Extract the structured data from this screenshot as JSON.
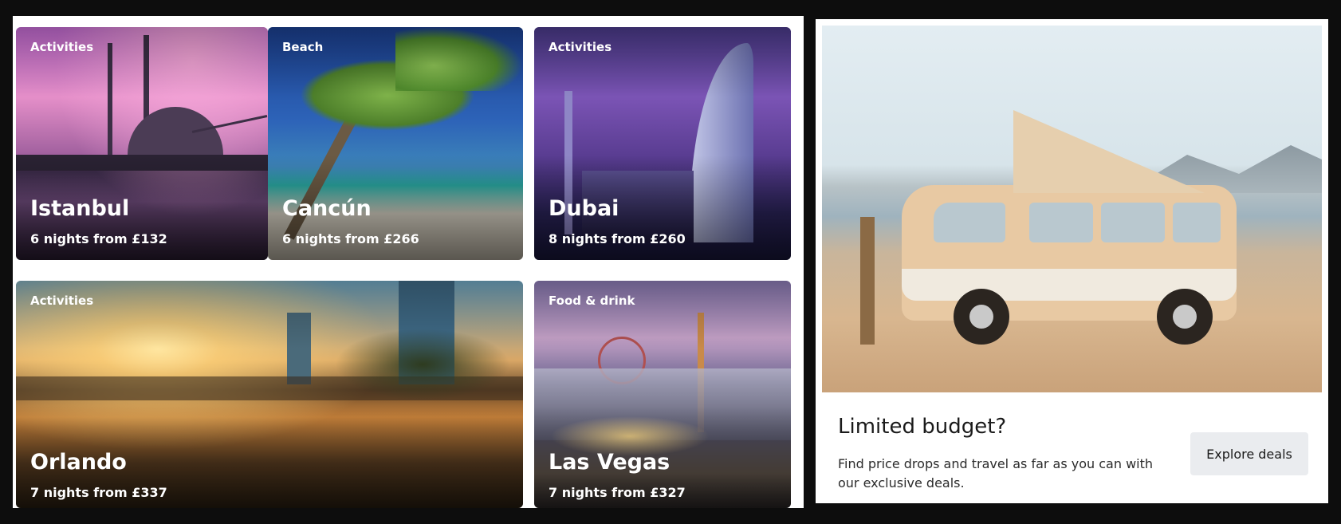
{
  "cards": [
    {
      "tag": "Activities",
      "city": "Istanbul",
      "price": "6 nights from £132"
    },
    {
      "tag": "Beach",
      "city": "Cancún",
      "price": "6 nights from £266"
    },
    {
      "tag": "Activities",
      "city": "Dubai",
      "price": "8 nights from £260"
    },
    {
      "tag": "Activities",
      "city": "Orlando",
      "price": "7 nights from £337"
    },
    {
      "tag": "Food & drink",
      "city": "Las Vegas",
      "price": "7 nights from £327"
    }
  ],
  "promo": {
    "title": "Limited budget?",
    "text": "Find price drops and travel as far as you can with our exclusive deals.",
    "button_label": "Explore deals"
  }
}
